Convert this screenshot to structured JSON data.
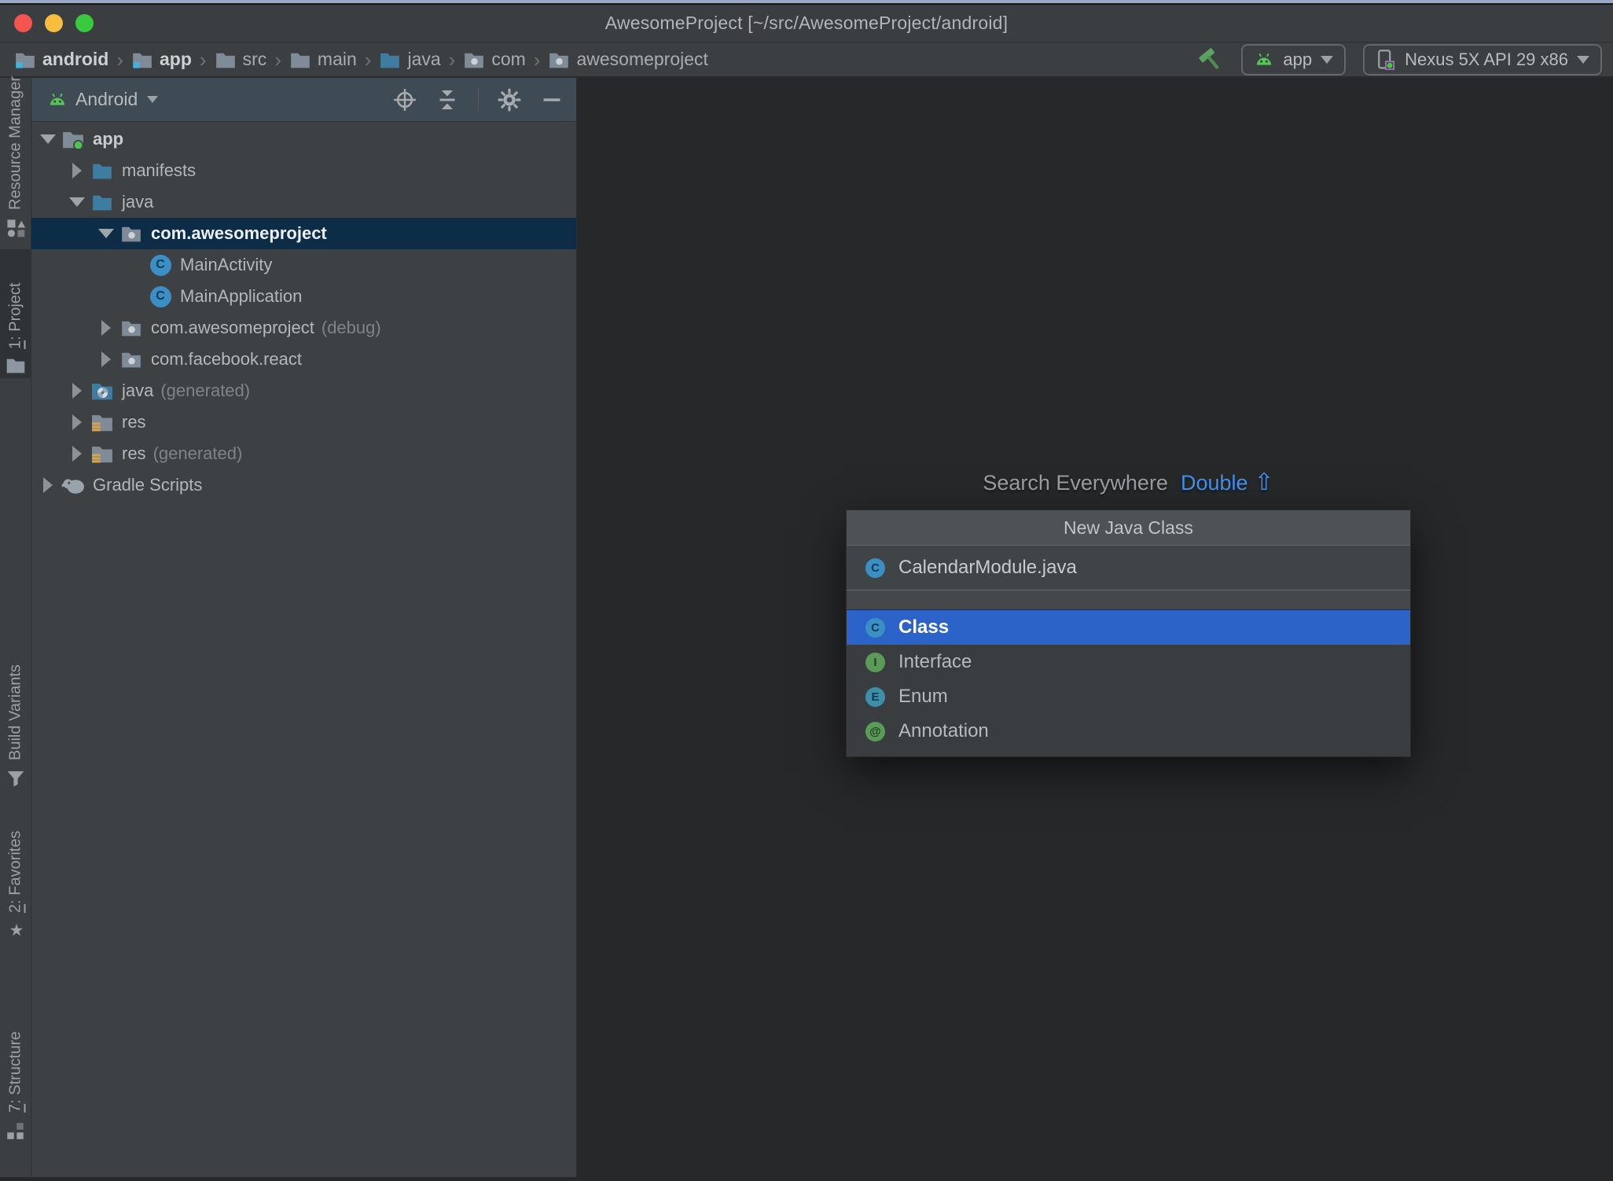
{
  "window": {
    "title": "AwesomeProject [~/src/AwesomeProject/android]"
  },
  "toolbar": {
    "breadcrumbs": [
      {
        "label": "android",
        "icon": "module-folder",
        "bold": true
      },
      {
        "label": "app",
        "icon": "module-folder",
        "bold": true
      },
      {
        "label": "src",
        "icon": "folder"
      },
      {
        "label": "main",
        "icon": "folder"
      },
      {
        "label": "java",
        "icon": "source-folder"
      },
      {
        "label": "com",
        "icon": "package-folder"
      },
      {
        "label": "awesomeproject",
        "icon": "package-folder"
      }
    ],
    "separator": "›",
    "build_button": {
      "icon": "hammer"
    },
    "run_config": {
      "label": "app",
      "icon": "android-head"
    },
    "device_select": {
      "label": "Nexus 5X API 29 x86",
      "icon": "device-phone"
    }
  },
  "stripe": {
    "items": [
      {
        "id": "resource-manager",
        "mnemonic": null,
        "label": "Resource Manager",
        "icon": "shapes",
        "active": false
      },
      {
        "id": "project",
        "mnemonic": "1",
        "label": "Project",
        "icon": "folder",
        "active": true
      },
      {
        "id": "build-variants",
        "mnemonic": null,
        "label": "Build Variants",
        "icon": "variants",
        "active": false
      },
      {
        "id": "favorites",
        "mnemonic": "2",
        "label": "Favorites",
        "icon": "star",
        "active": false
      },
      {
        "id": "structure",
        "mnemonic": "7",
        "label": "Structure",
        "icon": "structure",
        "active": false
      }
    ]
  },
  "panel": {
    "header": {
      "view": "Android"
    },
    "tree": [
      {
        "indent": 0,
        "twisty": "expanded",
        "icon": "android-module-folder",
        "label": "app",
        "bold": true
      },
      {
        "indent": 1,
        "twisty": "collapsed",
        "icon": "source-folder",
        "label": "manifests"
      },
      {
        "indent": 1,
        "twisty": "expanded",
        "icon": "source-folder",
        "label": "java"
      },
      {
        "indent": 2,
        "twisty": "expanded",
        "icon": "package-folder",
        "label": "com.awesomeproject",
        "selected": true
      },
      {
        "indent": 3,
        "twisty": "none",
        "icon": "class",
        "label": "MainActivity"
      },
      {
        "indent": 3,
        "twisty": "none",
        "icon": "class",
        "label": "MainApplication"
      },
      {
        "indent": 2,
        "twisty": "collapsed",
        "icon": "package-folder",
        "label": "com.awesomeproject",
        "suffix": "(debug)"
      },
      {
        "indent": 2,
        "twisty": "collapsed",
        "icon": "package-folder",
        "label": "com.facebook.react"
      },
      {
        "indent": 1,
        "twisty": "collapsed",
        "icon": "generated-source-folder",
        "label": "java",
        "suffix": "(generated)"
      },
      {
        "indent": 1,
        "twisty": "collapsed",
        "icon": "res-folder",
        "label": "res"
      },
      {
        "indent": 1,
        "twisty": "collapsed",
        "icon": "res-folder",
        "label": "res",
        "suffix": "(generated)"
      },
      {
        "indent": 0,
        "twisty": "collapsed",
        "icon": "gradle-elephant",
        "label": "Gradle Scripts"
      }
    ]
  },
  "editor": {
    "hint": {
      "text": "Search Everywhere",
      "action": "Double",
      "symbol": "⇧"
    }
  },
  "popup": {
    "title": "New Java Class",
    "input": {
      "value": "CalendarModule.java",
      "icon": "class",
      "letter": "C"
    },
    "options": [
      {
        "label": "Class",
        "kind": "class",
        "letter": "C",
        "selected": true
      },
      {
        "label": "Interface",
        "kind": "interface",
        "letter": "I",
        "selected": false
      },
      {
        "label": "Enum",
        "kind": "enum",
        "letter": "E",
        "selected": false
      },
      {
        "label": "Annotation",
        "kind": "annotation",
        "letter": "@",
        "selected": false
      }
    ]
  },
  "colors": {
    "selection_blue": "#2c63c8",
    "tree_selection_navy": "#0d2c45",
    "android_green": "#57c25a",
    "hammer_green": "#5aa25f",
    "link_blue": "#4193f0",
    "module_accent_cyan": "#41b1e0",
    "res_orange": "#e0a23c",
    "class_icon": "#3c8fc4",
    "interface_icon": "#5c9a58",
    "enum_icon": "#3d8fa9",
    "annotation_icon": "#5c9a58",
    "traffic_red": "#f4564f",
    "traffic_yellow": "#f6bd3e",
    "traffic_green": "#39c93f",
    "titlebar_bg": "#3b3e40",
    "panel_header_bg": "#3e4a54",
    "tree_bg": "#3d4144",
    "editor_bg": "#272829",
    "popup_header_bg": "#4d5255"
  }
}
